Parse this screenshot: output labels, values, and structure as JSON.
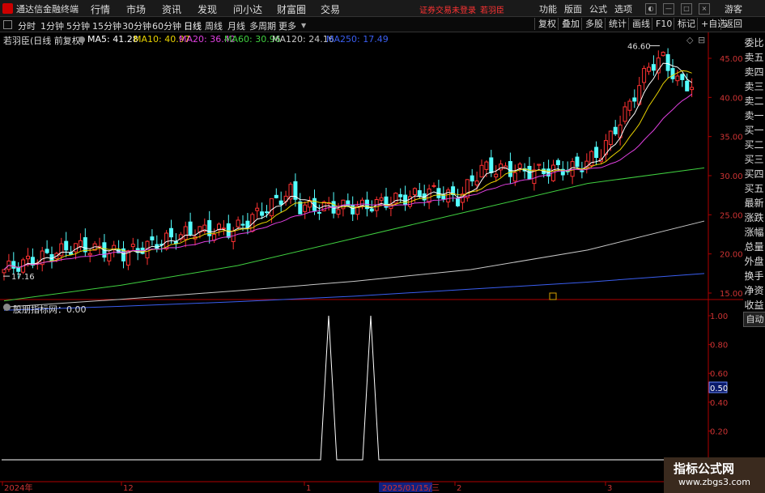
{
  "titlebar": {
    "app_name": "通达信金融终端",
    "menu": [
      "行情",
      "市场",
      "资讯",
      "发现",
      "问小达",
      "财富圈",
      "交易"
    ],
    "notice": "证券交易未登录",
    "username": "若羽臣",
    "right_menu": [
      "功能",
      "版面",
      "公式",
      "选项"
    ],
    "guest": "游客"
  },
  "periods": [
    "分时",
    "1分钟",
    "5分钟",
    "15分钟",
    "30分钟",
    "60分钟",
    "日线",
    "周线",
    "月线",
    "多周期",
    "更多"
  ],
  "active_period": "日线",
  "toolbar": [
    "复权",
    "叠加",
    "多股",
    "统计",
    "画线",
    "F10",
    "标记",
    "+自选",
    "返回"
  ],
  "price_panel": {
    "legend_title": "若羽臣(日线 前复权)",
    "ma": [
      {
        "label": "MA5: 41.28",
        "color": "#ffffff"
      },
      {
        "label": "MA10: 40.97",
        "color": "#e8d200"
      },
      {
        "label": "MA20: 36.42",
        "color": "#e040e0"
      },
      {
        "label": "MA60: 30.96",
        "color": "#40d040"
      },
      {
        "label": "MA120: 24.16",
        "color": "#c8c8c8"
      },
      {
        "label": "MA250: 17.49",
        "color": "#3a5ef0"
      }
    ],
    "y_ticks": [
      "45.00",
      "40.00",
      "35.00",
      "30.00",
      "25.00",
      "20.00",
      "15.00"
    ],
    "high_label": "46.60",
    "low_label": "17.16"
  },
  "indicator_panel": {
    "legend": "股朋指标网：0.00",
    "y_ticks": [
      "1.00",
      "0.80",
      "0.60",
      "0.50",
      "0.40",
      "0.20"
    ],
    "highlight_value": "0.50"
  },
  "x_axis": [
    "2024年",
    "12",
    "1",
    "2025/01/15/三",
    "2",
    "3"
  ],
  "side_panel": [
    "委比",
    "卖五",
    "卖四",
    "卖三",
    "卖二",
    "卖一",
    "买一",
    "买二",
    "买三",
    "买四",
    "买五",
    "最新",
    "涨跌",
    "涨幅",
    "总量",
    "外盘",
    "换手",
    "净资",
    "收益"
  ],
  "auto_label": "自动",
  "watermark": {
    "title": "指标公式网",
    "url": "www.zbgs3.com"
  },
  "colors": {
    "up": "#ff3232",
    "down": "#54ffff",
    "axis": "#b00000",
    "background": "#000000"
  }
}
